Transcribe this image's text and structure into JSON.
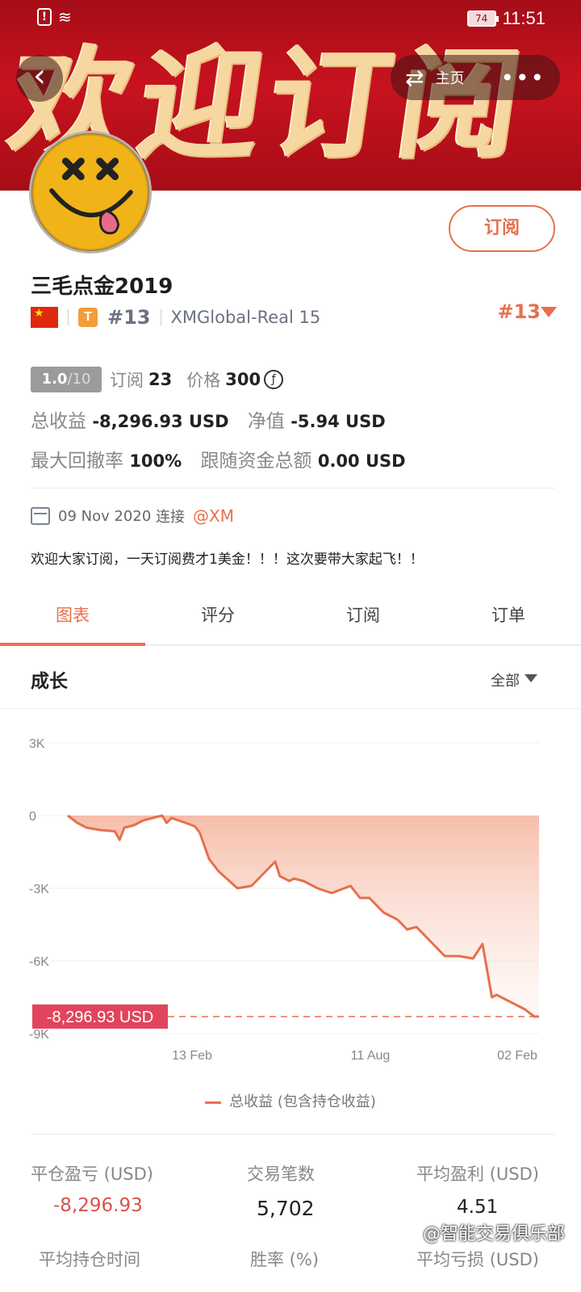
{
  "status_bar": {
    "battery": "74",
    "time": "11:51"
  },
  "banner": {
    "text": "欢迎订阅"
  },
  "header": {
    "home_label": "主页",
    "back_icon": "chevron-left-icon",
    "swap_icon": "swap-icon",
    "more_icon": "more-icon"
  },
  "profile": {
    "subscribe_label": "订阅",
    "name": "三毛点金2019",
    "tier_badge": "T",
    "rank": "#13",
    "account": "XMGlobal-Real 15",
    "rank_right": "#13"
  },
  "stats": {
    "score": "1.0",
    "score_total": "/10",
    "subscriptions_label": "订阅",
    "subscriptions_value": "23",
    "price_label": "价格",
    "price_value": "300",
    "coin_symbol": "ƒ",
    "total_profit_label": "总收益",
    "total_profit_value": "-8,296.93 USD",
    "equity_label": "净值",
    "equity_value": "-5.94 USD",
    "max_drawdown_label": "最大回撤率",
    "max_drawdown_value": "100%",
    "follower_funds_label": "跟随资金总额",
    "follower_funds_value": "0.00 USD"
  },
  "connection": {
    "date": "09 Nov 2020",
    "label": "连接",
    "broker": "@XM"
  },
  "description": "欢迎大家订阅，一天订阅费才1美金！！！这次要带大家起飞！！",
  "tabs": [
    {
      "label": "图表",
      "active": true
    },
    {
      "label": "评分",
      "active": false
    },
    {
      "label": "订阅",
      "active": false
    },
    {
      "label": "订单",
      "active": false
    }
  ],
  "growth": {
    "title": "成长",
    "range": "全部"
  },
  "chart_data": {
    "type": "area",
    "title": "",
    "ylim": [
      -9000,
      3000
    ],
    "y_ticks": [
      "3K",
      "0",
      "-3K",
      "-6K",
      "-9K"
    ],
    "y_tick_values": [
      3000,
      0,
      -3000,
      -6000,
      -9000
    ],
    "x_ticks": [
      "13 Feb",
      "11 Aug",
      "02 Feb"
    ],
    "x_tick_positions": [
      0.32,
      0.66,
      0.94
    ],
    "current_value_label": "-8,296.93 USD",
    "current_value": -8296.93,
    "legend": "总收益 (包含持仓收益)",
    "color": "#e7704c",
    "series": [
      {
        "name": "总收益 (包含持仓收益)",
        "x": [
          0,
          0.02,
          0.04,
          0.07,
          0.1,
          0.11,
          0.12,
          0.14,
          0.16,
          0.18,
          0.2,
          0.21,
          0.22,
          0.25,
          0.27,
          0.28,
          0.3,
          0.32,
          0.36,
          0.39,
          0.42,
          0.44,
          0.45,
          0.47,
          0.48,
          0.5,
          0.53,
          0.56,
          0.6,
          0.62,
          0.64,
          0.67,
          0.7,
          0.72,
          0.74,
          0.77,
          0.78,
          0.8,
          0.83,
          0.86,
          0.88,
          0.9,
          0.91,
          0.92,
          0.95,
          0.97,
          0.99,
          1.0
        ],
        "y": [
          0,
          -300,
          -500,
          -600,
          -650,
          -1000,
          -500,
          -400,
          -200,
          -100,
          0,
          -300,
          -100,
          -300,
          -450,
          -700,
          -1800,
          -2300,
          -3000,
          -2900,
          -2300,
          -1900,
          -2500,
          -2700,
          -2600,
          -2700,
          -3000,
          -3200,
          -2900,
          -3400,
          -3400,
          -4000,
          -4300,
          -4700,
          -4600,
          -5200,
          -5400,
          -5800,
          -5800,
          -5900,
          -5300,
          -7500,
          -7400,
          -7500,
          -7800,
          -8000,
          -8300,
          -8296.93
        ]
      }
    ]
  },
  "metrics": [
    {
      "label": "平仓盈亏 (USD)",
      "value": "-8,296.93",
      "color": "#d9534f"
    },
    {
      "label": "交易笔数",
      "value": "5,702",
      "color": "#222222"
    },
    {
      "label": "平均盈利 (USD)",
      "value": "4.51",
      "color": "#222222"
    },
    {
      "label": "平均持仓时间",
      "value": ""
    },
    {
      "label": "胜率 (%)",
      "value": ""
    },
    {
      "label": "平均亏损 (USD)",
      "value": ""
    }
  ],
  "watermark": "@智能交易俱乐部"
}
